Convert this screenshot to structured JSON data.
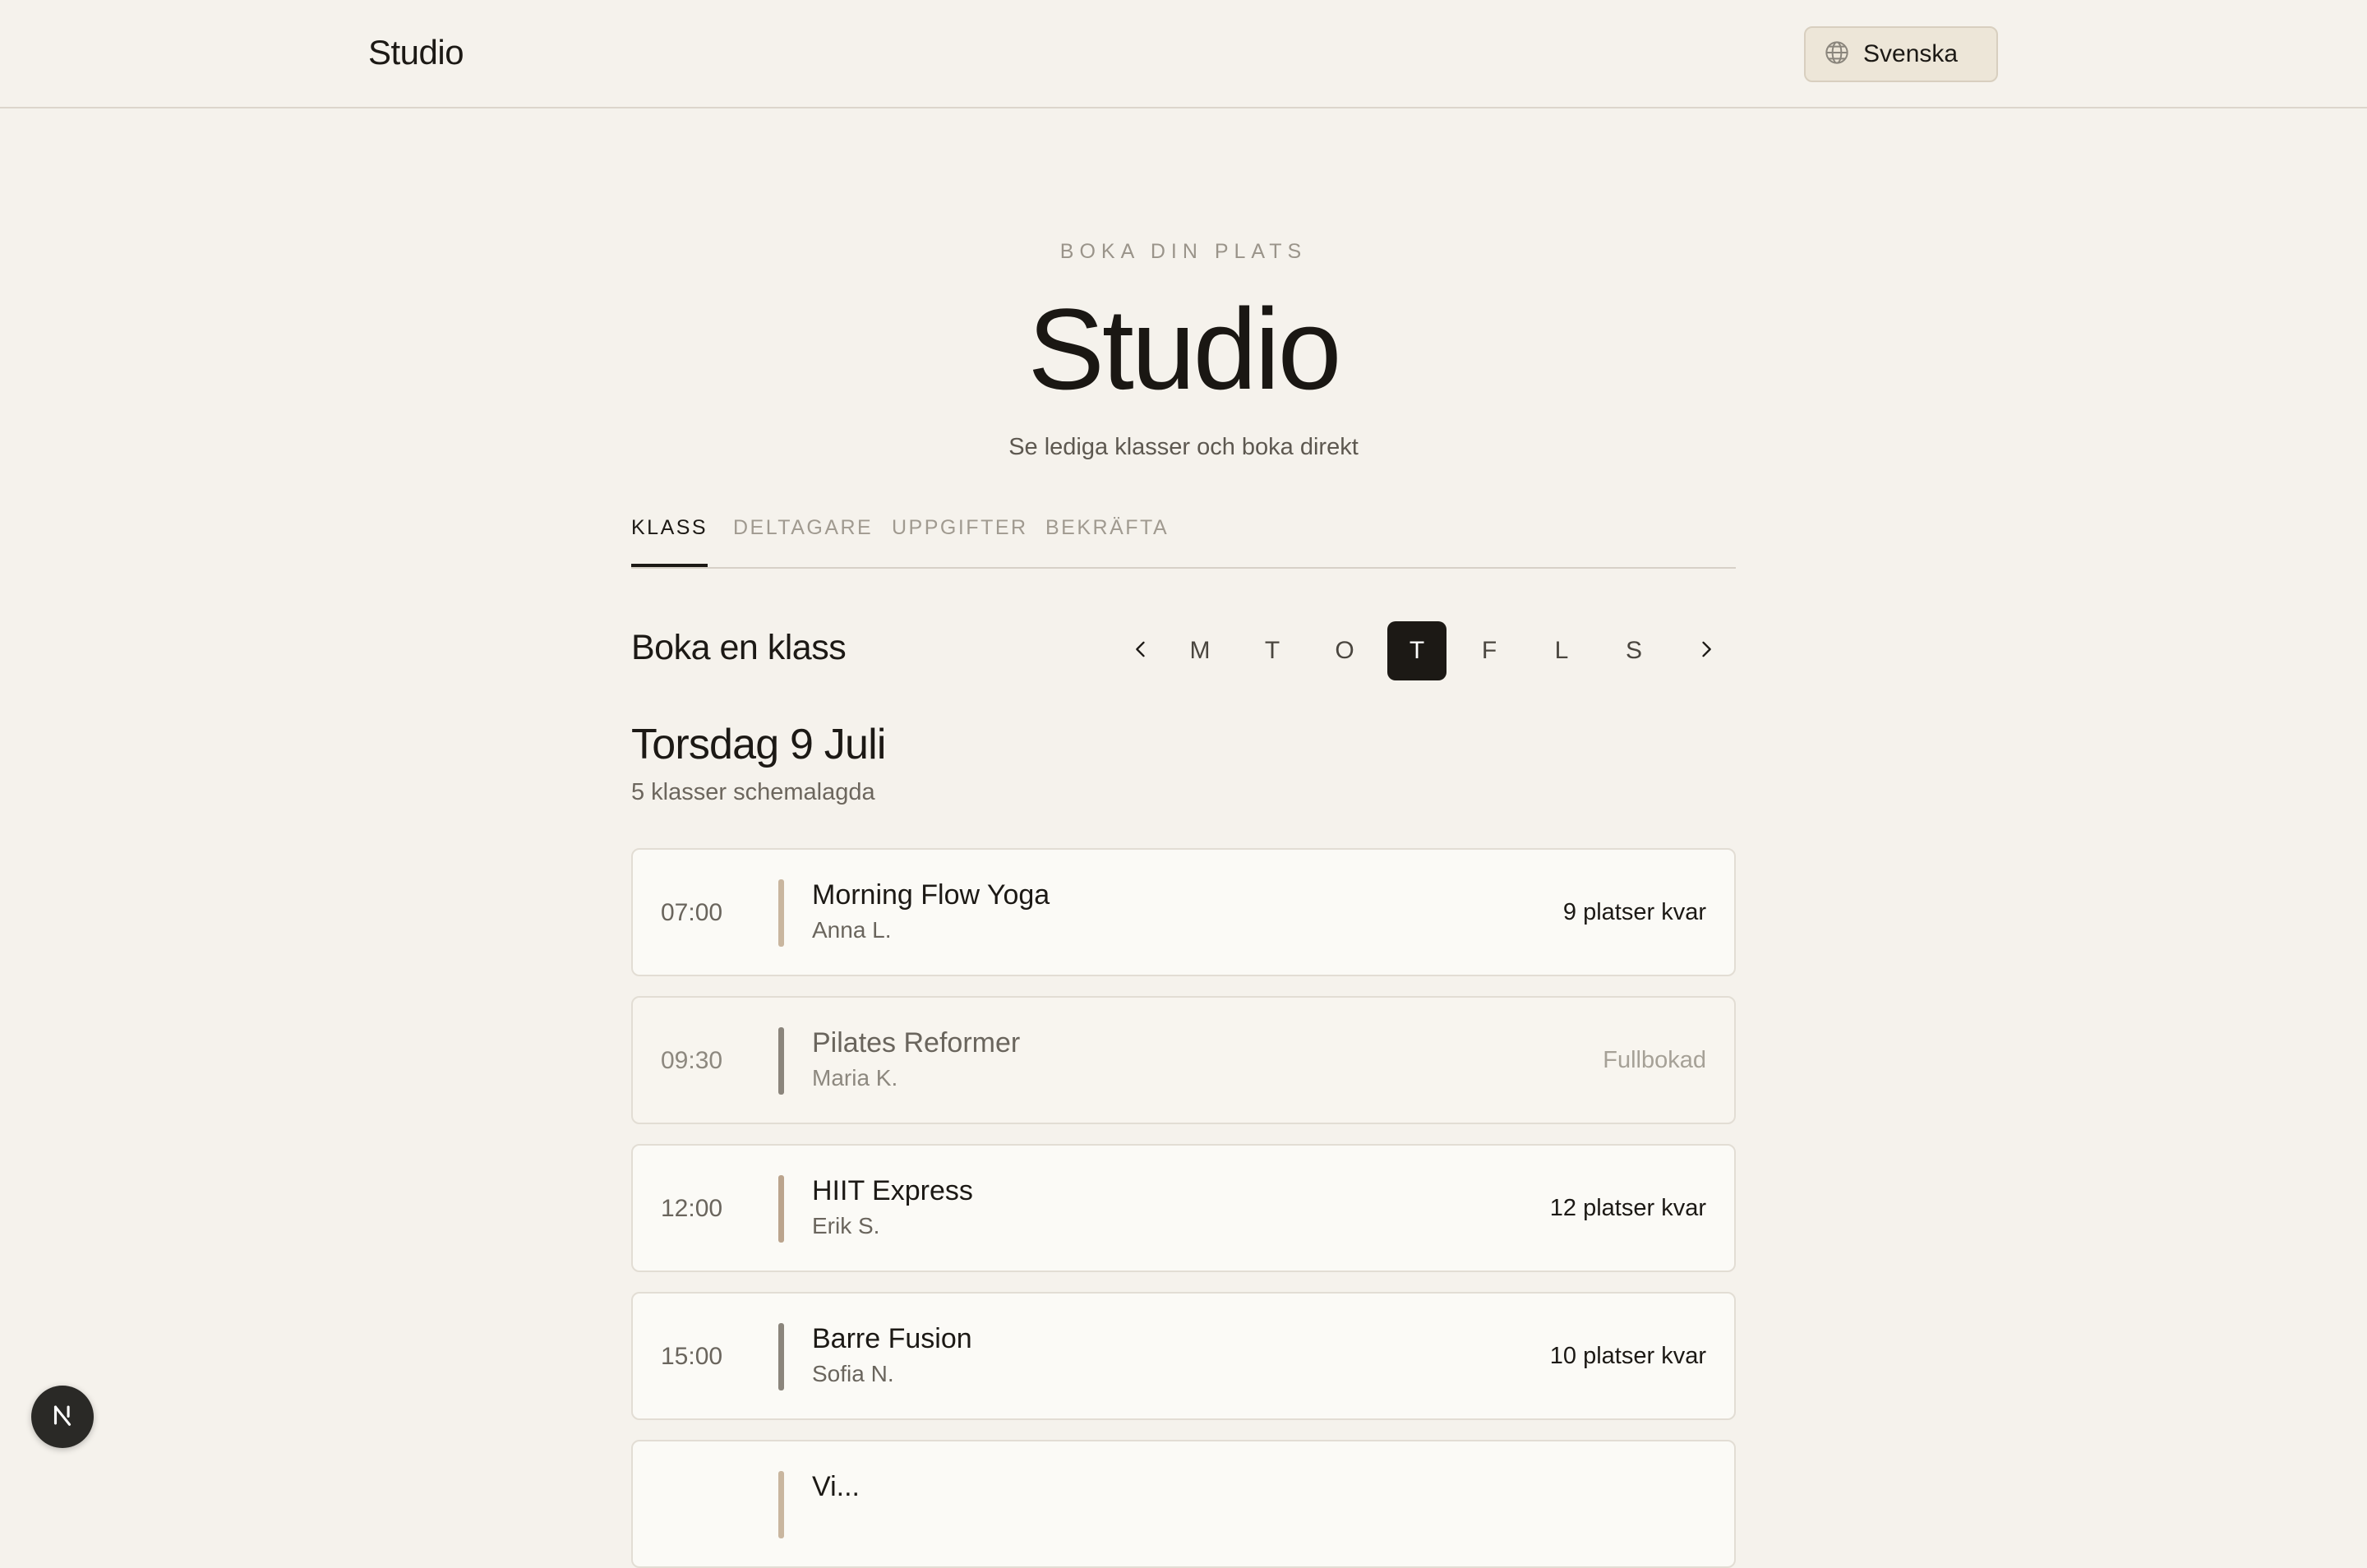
{
  "header": {
    "brand": "Studio",
    "language": "Svenska"
  },
  "hero": {
    "eyebrow": "BOKA DIN PLATS",
    "title": "Studio",
    "subtitle": "Se lediga klasser och boka direkt"
  },
  "tabs": [
    {
      "label": "KLASS",
      "active": true
    },
    {
      "label": "DELTAGARE",
      "active": false
    },
    {
      "label": "UPPGIFTER",
      "active": false
    },
    {
      "label": "BEKRÄFTA",
      "active": false
    }
  ],
  "booking": {
    "title": "Boka en klass",
    "days": [
      "M",
      "T",
      "O",
      "T",
      "F",
      "L",
      "S"
    ],
    "selected_day_index": 3,
    "date_heading": "Torsdag 9 Juli",
    "date_sub": "5 klasser schemalagda"
  },
  "classes": [
    {
      "time": "07:00",
      "name": "Morning Flow Yoga",
      "teacher": "Anna L.",
      "spots": "9 platser kvar",
      "accent": "#c9b69f"
    },
    {
      "time": "09:30",
      "name": "Pilates Reformer",
      "teacher": "Maria K.",
      "spots": "Fullbokad",
      "accent": "#8b857c"
    },
    {
      "time": "12:00",
      "name": "HIIT Express",
      "teacher": "Erik S.",
      "spots": "12 platser kvar",
      "accent": "#bba48d"
    },
    {
      "time": "15:00",
      "name": "Barre Fusion",
      "teacher": "Sofia N.",
      "spots": "10 platser kvar",
      "accent": "#8b857c"
    },
    {
      "time": "",
      "name": "Vi...",
      "teacher": "",
      "spots": "",
      "accent": "#c9b69f"
    }
  ],
  "colors": {
    "background": "#f5f2ec",
    "ink": "#1c1915",
    "muted": "#9a948a"
  },
  "icons": {
    "language": "globe-icon",
    "prev": "chevron-left-icon",
    "next": "chevron-right-icon",
    "dev": "n-logo-icon"
  }
}
